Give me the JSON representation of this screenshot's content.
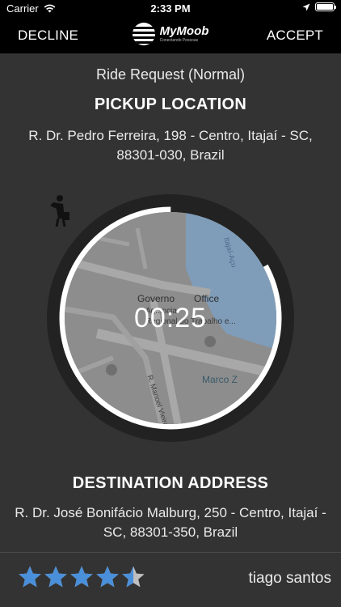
{
  "status_bar": {
    "carrier": "Carrier",
    "time": "2:33 PM",
    "battery_level": 1.0
  },
  "nav": {
    "decline_label": "DECLINE",
    "accept_label": "ACCEPT",
    "logo_name": "MyMoob",
    "logo_subtitle": "Conectando Pessoas"
  },
  "ride": {
    "request_type": "Ride Request (Normal)",
    "pickup_title": "PICKUP LOCATION",
    "pickup_address": "R. Dr. Pedro Ferreira,  198 - Centro,  Itajaí - SC,  88301-030,  Brazil",
    "timer": "00:25",
    "timer_progress": 0.83,
    "destination_title": "DESTINATION ADDRESS",
    "destination_address": "R. Dr. José Bonifácio Malburg,  250 - Centro, Itajaí - SC,  88301-350,  Brazil"
  },
  "map": {
    "labels": {
      "government": "Governo",
      "office": "Office",
      "regional": "Regional do Trabalho e...",
      "agency": "Ag...ncia",
      "street1": "R. Manoel Vieira G",
      "street2": "Marco Z",
      "river": "Itajaí-Açu"
    }
  },
  "passenger": {
    "name": "tiago santos",
    "rating": 4.5,
    "rating_max": 5
  },
  "colors": {
    "background": "#333333",
    "star": "#4a8fd9",
    "star_empty": "#bfbfbf",
    "water": "#7f9db9",
    "ring": "#222222"
  }
}
